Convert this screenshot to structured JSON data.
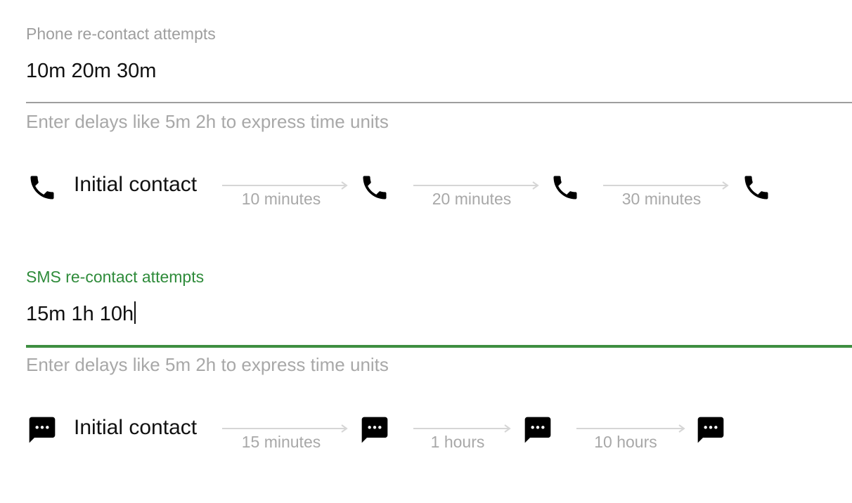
{
  "phone": {
    "label": "Phone re-contact attempts",
    "value": "10m 20m 30m",
    "hint": "Enter delays like 5m 2h to express time units",
    "initial_label": "Initial contact",
    "icon": "phone-icon",
    "delays": [
      "10 minutes",
      "20 minutes",
      "30 minutes"
    ]
  },
  "sms": {
    "label": "SMS re-contact attempts",
    "value": "15m 1h 10h",
    "hint": "Enter delays like 5m 2h to express time units",
    "initial_label": "Initial contact",
    "icon": "sms-icon",
    "delays": [
      "15 minutes",
      "1 hours",
      "10 hours"
    ]
  },
  "colors": {
    "accent": "#3e8e41",
    "muted": "#9e9e9e",
    "text": "#111111"
  }
}
